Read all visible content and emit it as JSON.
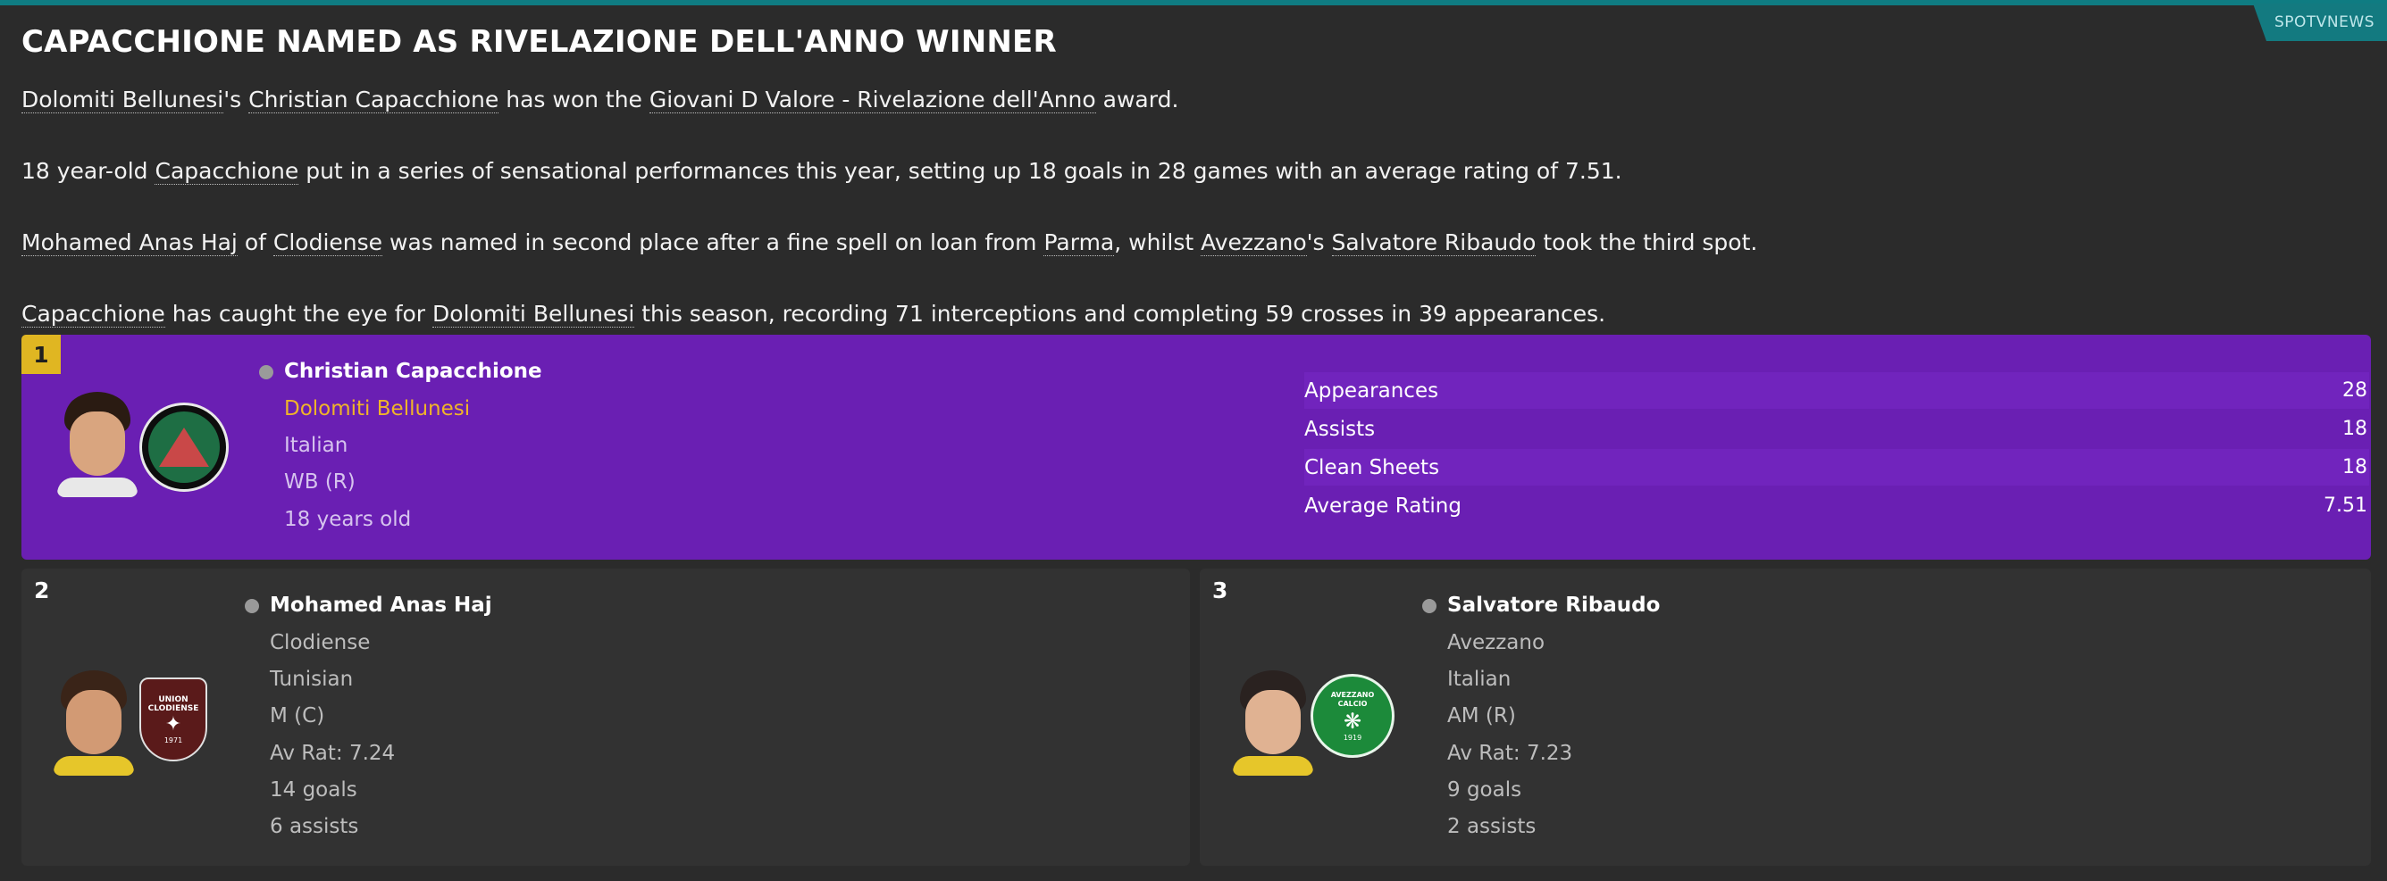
{
  "source_tag": "SPOTVNEWS",
  "headline": "CAPACCHIONE NAMED AS RIVELAZIONE DELL'ANNO WINNER",
  "paragraphs": {
    "p1": {
      "club": "Dolomiti Bellunesi",
      "t1": "'s ",
      "player": "Christian Capacchione",
      "t2": " has won the ",
      "award": "Giovani D Valore - Rivelazione dell'Anno",
      "t3": " award."
    },
    "p2": {
      "t1": "18 year-old ",
      "player": "Capacchione",
      "t2": " put in a series of sensational performances this year, setting up 18 goals in 28 games with an average rating of 7.51."
    },
    "p3": {
      "player2": "Mohamed Anas Haj",
      "t1": " of ",
      "club2": "Clodiense",
      "t2": " was named in second place after a fine spell on loan from ",
      "loan_club": "Parma",
      "t3": ", whilst ",
      "club3": "Avezzano",
      "t4": "'s ",
      "player3": "Salvatore Ribaudo",
      "t5": " took the third spot."
    },
    "p4": {
      "player": "Capacchione",
      "t1": " has caught the eye for ",
      "club": "Dolomiti Bellunesi",
      "t2": " this season, recording 71 interceptions and completing 59 crosses in 39 appearances."
    }
  },
  "winner": {
    "rank": "1",
    "name": "Christian Capacchione",
    "club": "Dolomiti Bellunesi",
    "nationality": "Italian",
    "position": "WB (R)",
    "age": "18 years old",
    "stats": [
      {
        "label": "Appearances",
        "value": "28"
      },
      {
        "label": "Assists",
        "value": "18"
      },
      {
        "label": "Clean Sheets",
        "value": "18"
      },
      {
        "label": "Average Rating",
        "value": "7.51"
      }
    ]
  },
  "second": {
    "rank": "2",
    "name": "Mohamed Anas Haj",
    "club": "Clodiense",
    "nationality": "Tunisian",
    "position": "M (C)",
    "rating": "Av Rat: 7.24",
    "goals": "14 goals",
    "assists": "6 assists",
    "crest_text": "UNION CLODIENSE",
    "crest_year": "1971"
  },
  "third": {
    "rank": "3",
    "name": "Salvatore Ribaudo",
    "club": "Avezzano",
    "nationality": "Italian",
    "position": "AM (R)",
    "rating": "Av Rat: 7.23",
    "goals": "9 goals",
    "assists": "2 assists",
    "crest_text": "AVEZZANO CALCIO",
    "crest_year": "1919"
  },
  "colors": {
    "accent_teal": "#0f7c82",
    "winner_purple": "#6a1fb3",
    "rank_gold": "#e0b622",
    "winner_club": "#f0b429",
    "background": "#2b2b2b",
    "card": "#323232"
  }
}
